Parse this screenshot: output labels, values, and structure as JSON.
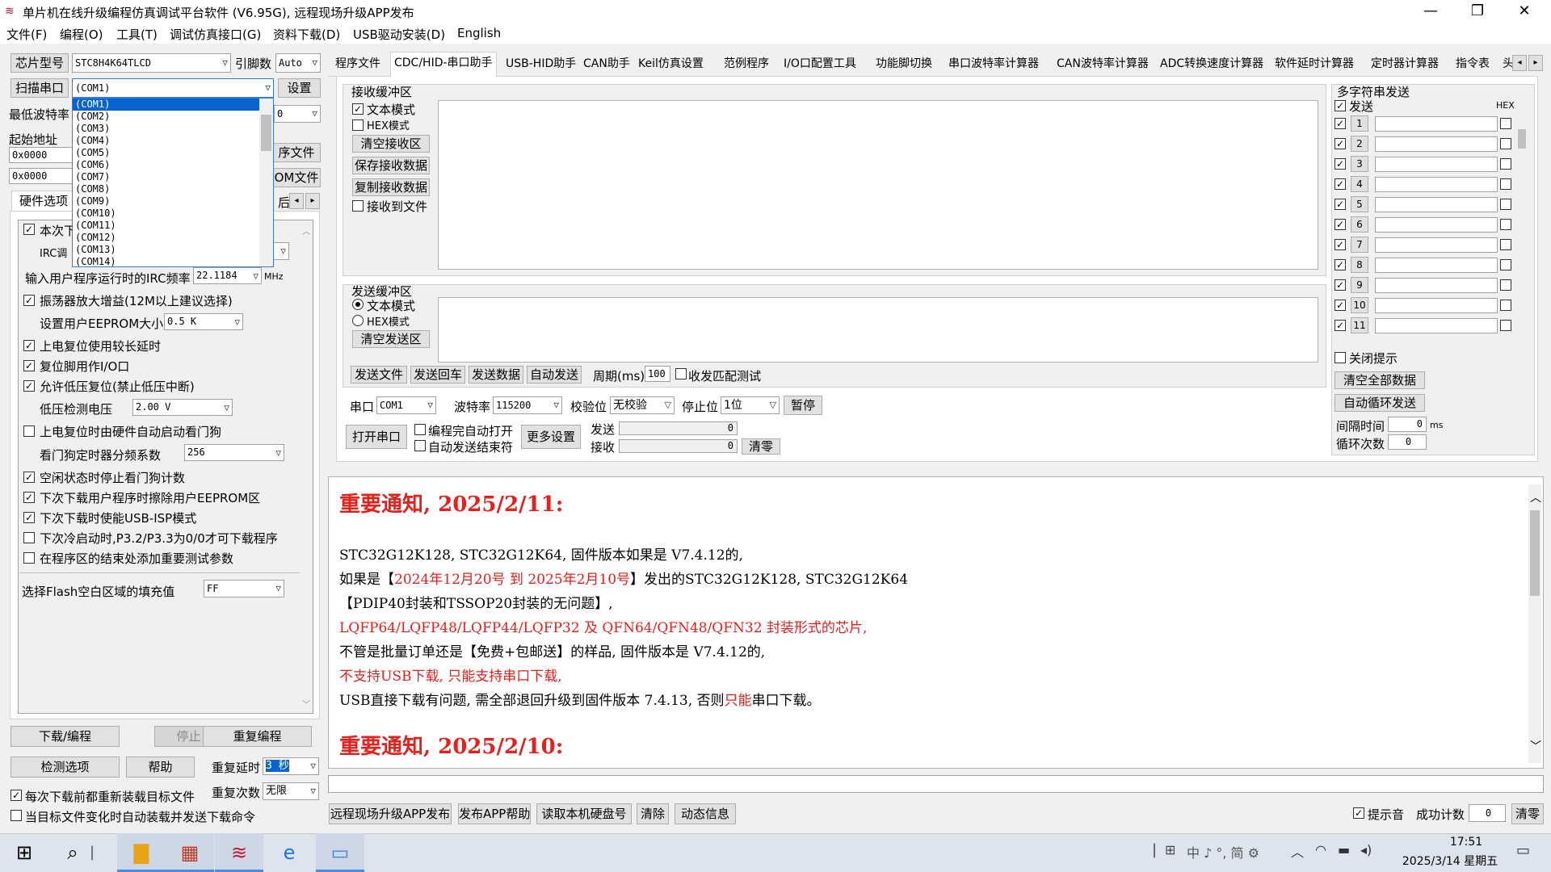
{
  "title": "单片机在线升级编程仿真调试平台软件 (V6.95G), 远程现场升级APP发布",
  "menu": [
    "文件(F)",
    "编程(O)",
    "工具(T)",
    "调试仿真接口(G)",
    "资料下载(D)",
    "USB驱动安装(D)",
    "English"
  ],
  "left": {
    "chip_label": "芯片型号",
    "chip_value": "STC8H4K64TLCD",
    "pin_label": "引脚数",
    "pin_value": "Auto",
    "scan_label": "扫描串口",
    "port_value": "(COM1)",
    "settings_label": "设置",
    "min_baud_label": "最低波特率",
    "start_addr_label": "起始地址",
    "addr1": "0x0000",
    "addr2": "0x0000",
    "open_prog_file": "序文件",
    "open_eep_file": "OM文件",
    "after_label": "后",
    "hw_tab": "硬件选项",
    "com_list": [
      "(COM1)",
      "(COM2)",
      "(COM3)",
      "(COM4)",
      "(COM5)",
      "(COM6)",
      "(COM7)",
      "(COM8)",
      "(COM9)",
      "(COM10)",
      "(COM11)",
      "(COM12)",
      "(COM13)",
      "(COM14)"
    ],
    "opt_this": "本次下",
    "opt_irc": "IRC调",
    "irc_freq_label": "输入用户程序运行时的IRC频率",
    "irc_freq": "22.1184",
    "mhz": "MHz",
    "opt_osc": "振荡器放大增益(12M以上建议选择)",
    "eeprom_label": "设置用户EEPROM大小",
    "eeprom_value": "0.5 K",
    "opt_reset_delay": "上电复位使用较长延时",
    "opt_reset_io": "复位脚用作I/O口",
    "opt_lvr": "允许低压复位(禁止低压中断)",
    "lv_label": "低压检测电压",
    "lv_value": "2.00 V",
    "opt_wdt": "上电复位时由硬件自动启动看门狗",
    "wdt_label": "看门狗定时器分频系数",
    "wdt_value": "256",
    "opt_idle": "空闲状态时停止看门狗计数",
    "opt_erase": "下次下载用户程序时擦除用户EEPROM区",
    "opt_usb": "下次下载时使能USB-ISP模式",
    "opt_cold": "下次冷启动时,P3.2/P3.3为0/0才可下载程序",
    "opt_test": "在程序区的结束处添加重要测试参数",
    "fill_label": "选择Flash空白区域的填充值",
    "fill_value": "FF",
    "btn_download": "下载/编程",
    "btn_stop": "停止",
    "btn_reprog": "重复编程",
    "btn_check": "检测选项",
    "btn_help": "帮助",
    "rep_delay_label": "重复延时",
    "rep_delay_value": "3 秒",
    "rep_count_label": "重复次数",
    "rep_count_value": "无限",
    "reload_label": "每次下载前都重新装载目标文件",
    "autoload_label": "当目标文件变化时自动装载并发送下载命令"
  },
  "tabs": [
    "程序文件",
    "CDC/HID-串口助手",
    "USB-HID助手",
    "CAN助手",
    "Keil仿真设置",
    "范例程序",
    "I/O口配置工具",
    "功能脚切换",
    "串口波特率计算器",
    "CAN波特率计算器",
    "ADC转换速度计算器",
    "软件延时计算器",
    "定时器计算器",
    "指令表",
    "头"
  ],
  "serial": {
    "rx_title": "接收缓冲区",
    "text_mode": "文本模式",
    "hex_mode": "HEX模式",
    "clear_rx": "清空接收区",
    "save_rx": "保存接收数据",
    "copy_rx": "复制接收数据",
    "rx_to_file": "接收到文件",
    "tx_title": "发送缓冲区",
    "clear_tx": "清空发送区",
    "send_file": "发送文件",
    "send_cr": "发送回车",
    "send_data": "发送数据",
    "auto_send": "自动发送",
    "period_label": "周期(ms)",
    "period_value": "100",
    "match_test": "收发匹配测试",
    "port_label": "串口",
    "port_value": "COM1",
    "baud_label": "波特率",
    "baud_value": "115200",
    "parity_label": "校验位",
    "parity_value": "无校验",
    "stop_label": "停止位",
    "stop_value": "1位",
    "pause": "暂停",
    "open_port": "打开串口",
    "auto_open": "编程完自动打开",
    "auto_end": "自动发送结束符",
    "more": "更多设置",
    "send_label": "发送",
    "send_count": "0",
    "recv_label": "接收",
    "recv_count": "0",
    "clear_count": "清零"
  },
  "multi": {
    "title": "多字符串发送",
    "send_hdr": "发送",
    "hex_hdr": "HEX",
    "rows": [
      "1",
      "2",
      "3",
      "4",
      "5",
      "6",
      "7",
      "8",
      "9",
      "10",
      "11"
    ],
    "close_tip": "关闭提示",
    "clear_all": "清空全部数据",
    "auto_loop": "自动循环发送",
    "interval_label": "间隔时间",
    "interval_value": "0",
    "ms": "ms",
    "loop_label": "循环次数",
    "loop_value": "0"
  },
  "notice": {
    "h1": "重要通知, 2025/2/11:",
    "l1": "STC32G12K128, STC32G12K64, 固件版本如果是 V7.4.12的,",
    "l2a": "如果是【",
    "l2b": "2024年12月20号 到 2025年2月10号",
    "l2c": "】发出的STC32G12K128, STC32G12K64",
    "l3": "【PDIP40封装和TSSOP20封装的无问题】,",
    "l4": "LQFP64/LQFP48/LQFP44/LQFP32 及 QFN64/QFN48/QFN32 封装形式的芯片,",
    "l5": "不管是批量订单还是【免费+包邮送】的样品, 固件版本是 V7.4.12的,",
    "l6": "不支持USB下载, 只能支持串口下载,",
    "l7a": "USB直接下载有问题, 需全部退回升级到固件版本 7.4.13, 否则",
    "l7b": "只能",
    "l7c": "串口下载。",
    "h2": "重要通知, 2025/2/10:"
  },
  "bottom": {
    "remote": "远程现场升级APP发布",
    "publish_help": "发布APP帮助",
    "read_disk": "读取本机硬盘号",
    "clear": "清除",
    "dynamic": "动态信息",
    "beep": "提示音",
    "success_label": "成功计数",
    "success_value": "0",
    "clear_count": "清零"
  },
  "taskbar": {
    "time": "17:51",
    "date": "2025/3/14 星期五",
    "ime": "中 ♪ °, 简 ⚙"
  }
}
